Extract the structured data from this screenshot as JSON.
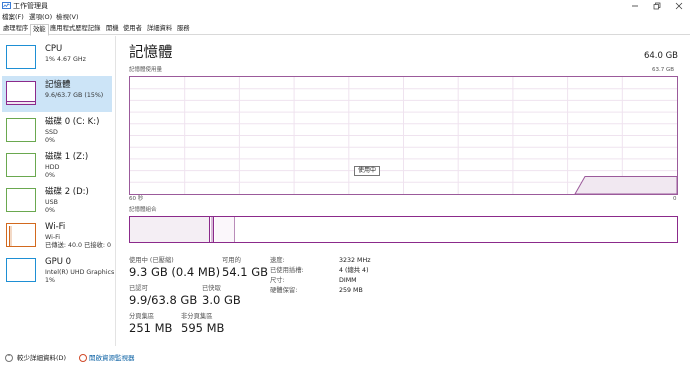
{
  "window": {
    "title": "工作管理員"
  },
  "menu": {
    "items": [
      "檔案(F)",
      "選項(O)",
      "檢視(V)"
    ]
  },
  "tabs": [
    "處理程序",
    "效能",
    "應用程式歷程記錄",
    "開機",
    "使用者",
    "詳細資料",
    "服務"
  ],
  "active_tab": "效能",
  "sidebar": {
    "items": [
      {
        "name": "CPU",
        "sub1": "1% 4.67 GHz",
        "sub2": "",
        "sub3": "",
        "color": "#1e8fd4",
        "active": false
      },
      {
        "name": "記憶體",
        "sub1": "9.6/63.7 GB (15%)",
        "sub2": "",
        "sub3": "",
        "color": "#8b2a8b",
        "active": true
      },
      {
        "name": "磁碟 0 (C: K:)",
        "sub1": "SSD",
        "sub2": "0%",
        "sub3": "",
        "color": "#6aa84f",
        "active": false
      },
      {
        "name": "磁碟 1 (Z:)",
        "sub1": "HDD",
        "sub2": "0%",
        "sub3": "",
        "color": "#6aa84f",
        "active": false
      },
      {
        "name": "磁碟 2 (D:)",
        "sub1": "USB",
        "sub2": "0%",
        "sub3": "",
        "color": "#6aa84f",
        "active": false
      },
      {
        "name": "Wi-Fi",
        "sub1": "Wi-Fi",
        "sub2": "已傳送: 40.0  已接收: 0",
        "sub3": "",
        "color": "#d2691e",
        "active": false
      },
      {
        "name": "GPU 0",
        "sub1": "Intel(R) UHD Graphics",
        "sub2": "1%",
        "sub3": "",
        "color": "#1e8fd4",
        "active": false
      }
    ]
  },
  "main": {
    "title": "記憶體",
    "total": "64.0 GB",
    "graph_label": "記憶體使用量",
    "graph_max": "63.7 GB",
    "x_left": "60 秒",
    "x_right": "0",
    "tooltip": "使用中",
    "composition_label": "記憶體組合",
    "usage_fraction": 0.15
  },
  "stats": {
    "in_use_label": "使用中 (已壓縮)",
    "in_use_value": "9.3 GB (0.4 MB)",
    "available_label": "可用的",
    "available_value": "54.1 GB",
    "committed_label": "已認可",
    "committed_value": "9.9/63.8 GB",
    "cached_label": "已快取",
    "cached_value": "3.0 GB",
    "paged_label": "分頁集區",
    "paged_value": "251 MB",
    "nonpaged_label": "非分頁集區",
    "nonpaged_value": "595 MB"
  },
  "details": [
    {
      "label": "速度:",
      "value": "3232 MHz"
    },
    {
      "label": "已使用插槽:",
      "value": "4 (總共 4)"
    },
    {
      "label": "尺寸:",
      "value": "DIMM"
    },
    {
      "label": "硬體保留:",
      "value": "259 MB"
    }
  ],
  "footer": {
    "fewer_details": "較少詳細資料(D)",
    "open_resmon": "開啟資源監視器"
  },
  "colors": {
    "memory_accent": "#8b2a8b",
    "selected_bg": "#cce4f7",
    "link": "#0b61a4"
  }
}
